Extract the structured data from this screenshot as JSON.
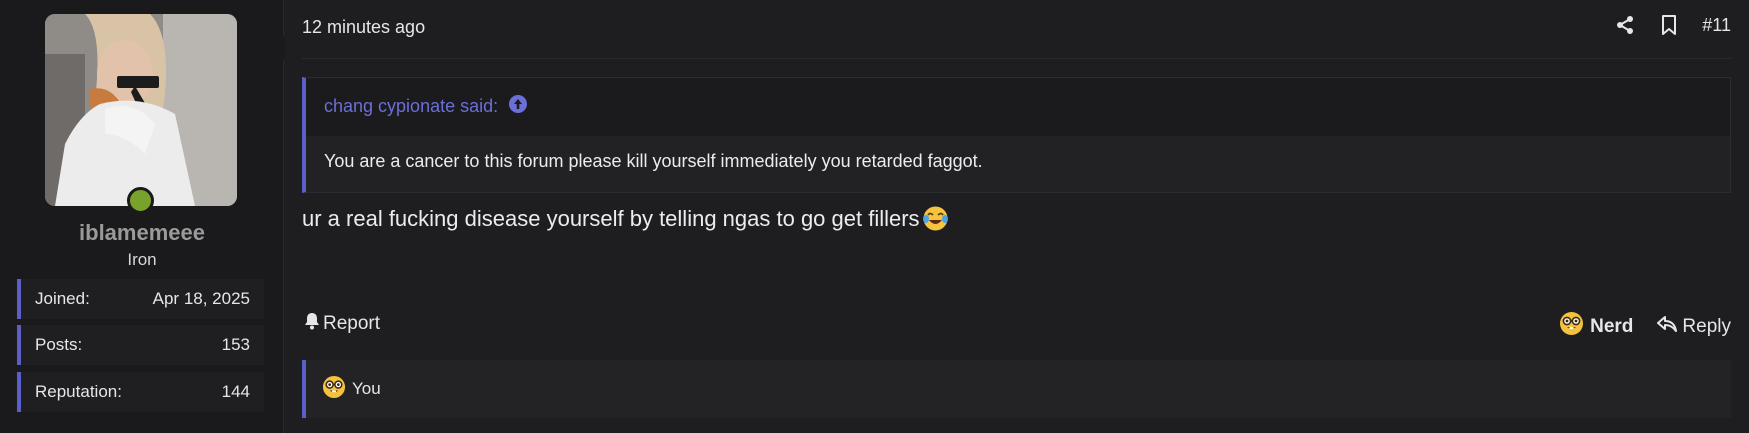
{
  "user": {
    "username": "iblamemeee",
    "title": "Iron",
    "online": true,
    "stats": [
      {
        "label": "Joined:",
        "value": "Apr 18, 2025"
      },
      {
        "label": "Posts:",
        "value": "153"
      },
      {
        "label": "Reputation:",
        "value": "144"
      }
    ]
  },
  "post": {
    "date": "12 minutes ago",
    "number": "#11",
    "quote": {
      "author_line": "chang cypionate said:",
      "text": "You are a cancer to this forum please kill yourself immediately you retarded faggot."
    },
    "message": "ur a real fucking disease yourself by telling ngas to go get fillers",
    "message_emoji": "face-with-tears-of-joy",
    "actions": {
      "report": "Report",
      "react": "Nerd",
      "reply": "Reply"
    },
    "reactions": {
      "emoji": "nerd-face",
      "text": "You"
    }
  },
  "colors": {
    "accent": "#5b5fc7",
    "online": "#79a22d",
    "background": "#1e1e20",
    "sidebar": "#1a1a1c"
  },
  "icons": [
    "share-icon",
    "bookmark-icon",
    "arrow-up-circle-icon",
    "bell-icon",
    "reply-arrow-icon",
    "nerd-face-emoji",
    "tears-of-joy-emoji"
  ]
}
